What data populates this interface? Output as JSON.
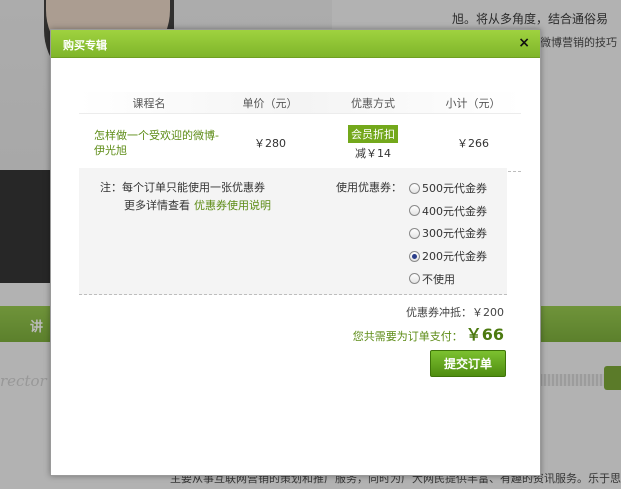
{
  "background": {
    "top_text": "旭。将从多角度，结合通俗易",
    "side_lines": [
      "微博营销的技巧"
    ],
    "greenbar_text": "讲",
    "director_text": "rector",
    "bottom_text": "主要从事互联网营销的策划和推广服务，同时为广大网民提供丰富、有趣的资讯服务。乐于思考"
  },
  "modal": {
    "title": "购买专辑",
    "close_glyph": "×",
    "columns": [
      "课程名",
      "单价（元）",
      "优惠方式",
      "小计（元）"
    ],
    "row": {
      "course_name": "怎样做一个受欢迎的微博-伊光旭",
      "price": "￥280",
      "discount_label": "会员折扣",
      "discount_amount": "减￥14",
      "subtotal": "￥266"
    },
    "note_label": "注：每个订单只能使用一张优惠券",
    "note_more": "更多详情查看",
    "note_link": "优惠券使用说明",
    "coupon_label": "使用优惠券：",
    "coupon_options": [
      {
        "label": "500元代金券",
        "selected": false
      },
      {
        "label": "400元代金券",
        "selected": false
      },
      {
        "label": "300元代金券",
        "selected": false
      },
      {
        "label": "200元代金券",
        "selected": true
      },
      {
        "label": "不使用",
        "selected": false
      }
    ],
    "offset_text": "优惠券冲抵：￥200",
    "total_label": "您共需要为订单支付：",
    "total_amount": "￥66",
    "submit_label": "提交订单"
  },
  "colors": {
    "accent_green": "#7fb52a",
    "link_green": "#5d8c16",
    "button_green": "#4f8d10"
  }
}
